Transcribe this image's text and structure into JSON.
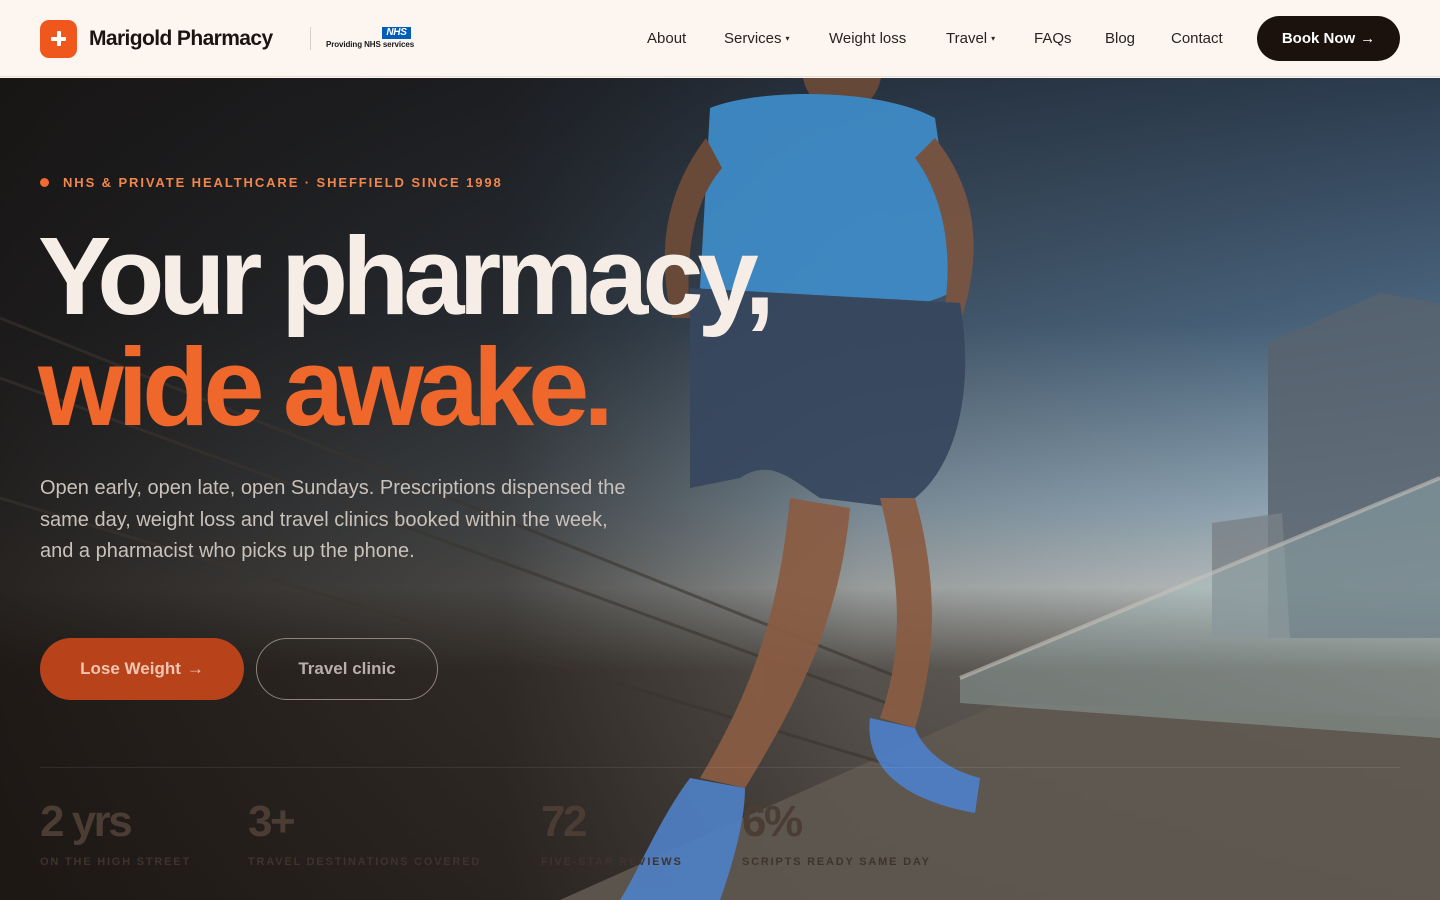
{
  "header": {
    "brand": "Marigold Pharmacy",
    "nhs_badge": "NHS",
    "nhs_text": "Providing NHS services",
    "nav": [
      {
        "label": "About",
        "has_caret": false
      },
      {
        "label": "Services",
        "has_caret": true
      },
      {
        "label": "Weight loss",
        "has_caret": false
      },
      {
        "label": "Travel",
        "has_caret": true
      },
      {
        "label": "FAQs",
        "has_caret": false
      },
      {
        "label": "Blog",
        "has_caret": false
      },
      {
        "label": "Contact",
        "has_caret": false
      }
    ],
    "caret_glyph": "▾",
    "cta": "Book Now",
    "cta_arrow": "→"
  },
  "hero": {
    "eyebrow": "NHS & PRIVATE HEALTHCARE · SHEFFIELD SINCE 1998",
    "headline_line1": "Your pharmacy,",
    "headline_line2": "wide awake.",
    "lead": "Open early, open late, open Sundays. Prescriptions dispensed the same day, weight loss and travel clinics booked within the week, and a pharmacist who picks up the phone.",
    "primary_cta": "Lose Weight",
    "primary_cta_arrow": "→",
    "secondary_cta": "Travel clinic",
    "stats": [
      {
        "value": "2 yrs",
        "label": "ON THE HIGH STREET"
      },
      {
        "value": "3+",
        "label": "TRAVEL DESTINATIONS COVERED"
      },
      {
        "value": "72",
        "label": "FIVE-STAR REVIEWS"
      },
      {
        "value": "6%",
        "label": "SCRIPTS READY SAME DAY"
      }
    ]
  },
  "colors": {
    "brand_orange": "#f0571c",
    "headline_orange": "#f0672c",
    "dark": "#1b120e",
    "nhs_blue": "#005eb8",
    "header_bg": "#fdf6f0"
  },
  "icons": {
    "logo": "plus-cross-icon",
    "arrow": "arrow-right-icon",
    "caret": "chevron-down-icon",
    "eyebrow_dot": "dot-icon"
  }
}
